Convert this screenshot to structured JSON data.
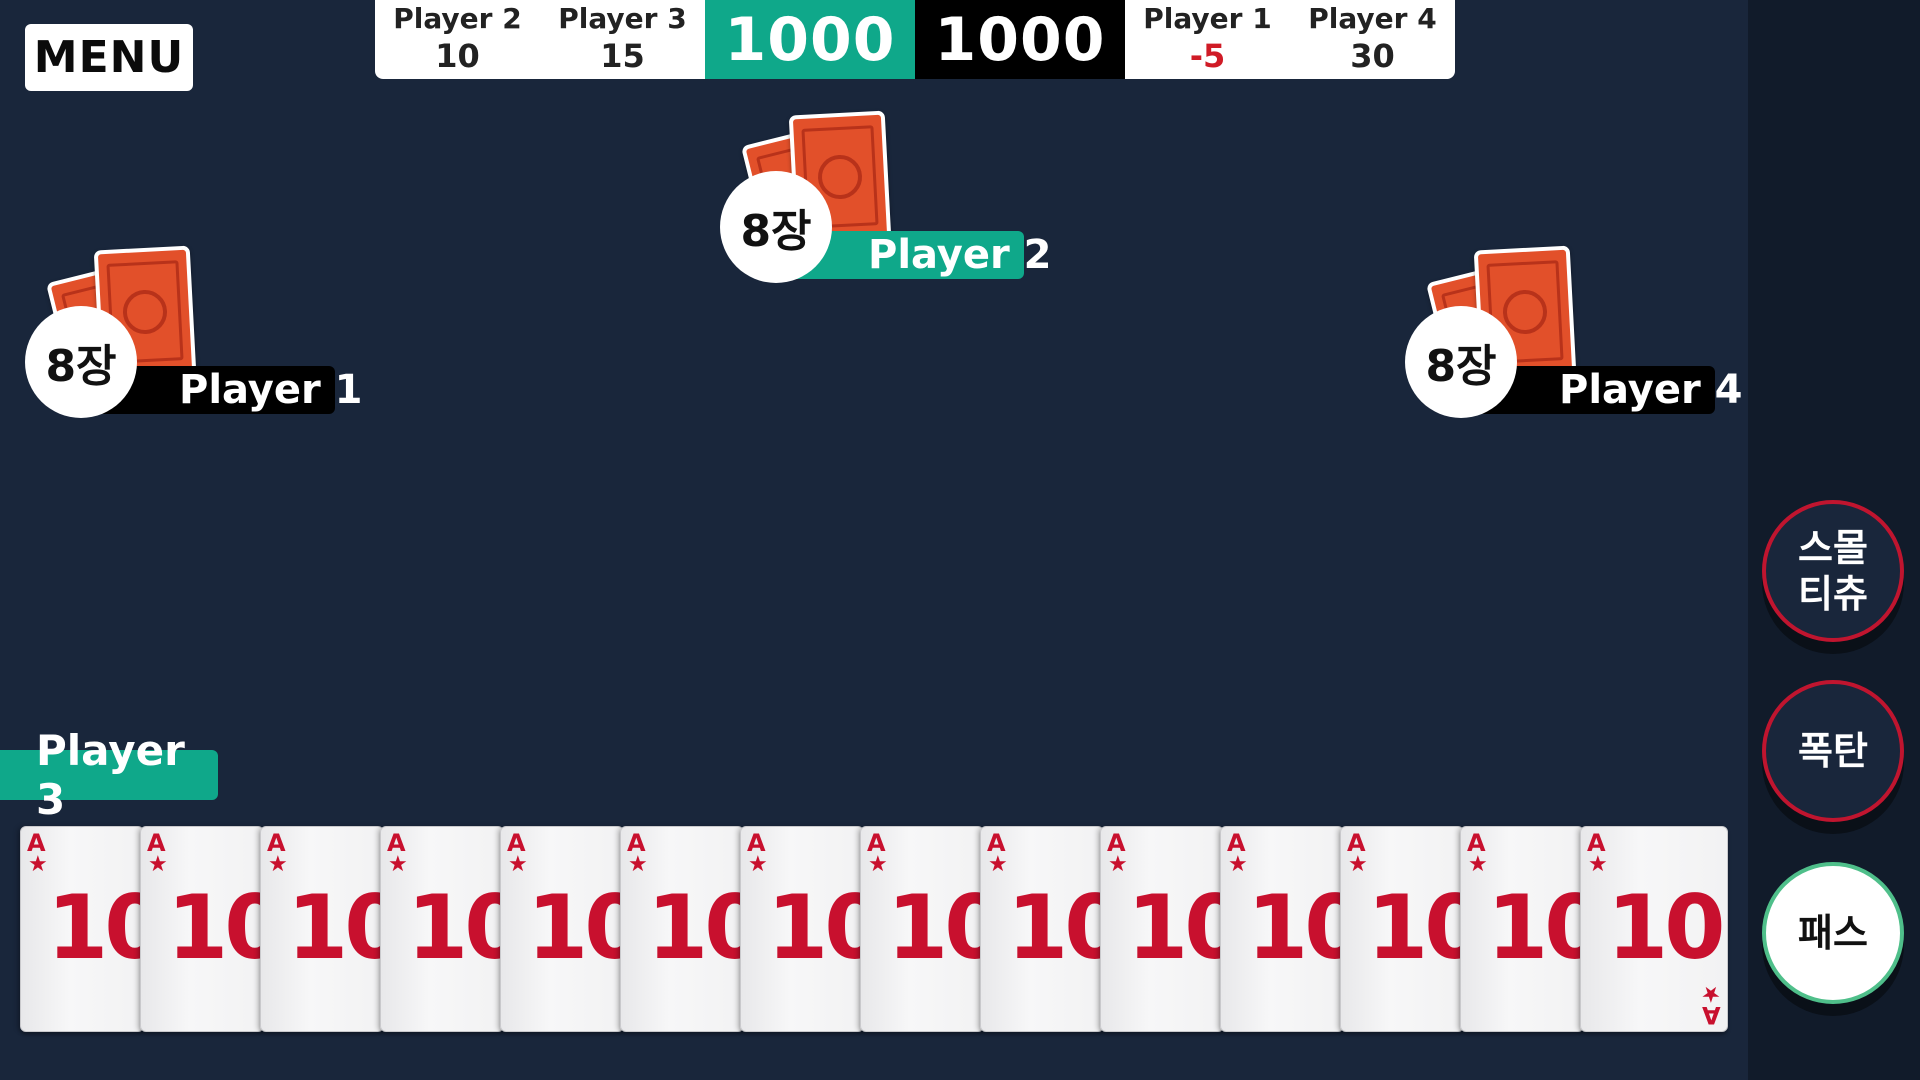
{
  "menu": {
    "label": "MENU"
  },
  "scoreboard": {
    "left": [
      {
        "name": "Player 2",
        "score": "10"
      },
      {
        "name": "Player 3",
        "score": "15"
      }
    ],
    "pot_teal": "1000",
    "pot_black": "1000",
    "right": [
      {
        "name": "Player 1",
        "score": "-5"
      },
      {
        "name": "Player 4",
        "score": "30"
      }
    ]
  },
  "opponents": {
    "player1": {
      "name": "Player 1",
      "count": "8장"
    },
    "player2": {
      "name": "Player 2",
      "count": "8장"
    },
    "player4": {
      "name": "Player 4",
      "count": "8장"
    }
  },
  "me": {
    "name": "Player 3"
  },
  "hand": {
    "cards": [
      {
        "rank": "A",
        "suit": "★",
        "value": "10"
      },
      {
        "rank": "A",
        "suit": "★",
        "value": "10"
      },
      {
        "rank": "A",
        "suit": "★",
        "value": "10"
      },
      {
        "rank": "A",
        "suit": "★",
        "value": "10"
      },
      {
        "rank": "A",
        "suit": "★",
        "value": "10"
      },
      {
        "rank": "A",
        "suit": "★",
        "value": "10"
      },
      {
        "rank": "A",
        "suit": "★",
        "value": "10"
      },
      {
        "rank": "A",
        "suit": "★",
        "value": "10"
      },
      {
        "rank": "A",
        "suit": "★",
        "value": "10"
      },
      {
        "rank": "A",
        "suit": "★",
        "value": "10"
      },
      {
        "rank": "A",
        "suit": "★",
        "value": "10"
      },
      {
        "rank": "A",
        "suit": "★",
        "value": "10"
      },
      {
        "rank": "A",
        "suit": "★",
        "value": "10"
      },
      {
        "rank": "A",
        "suit": "★",
        "value": "10"
      }
    ]
  },
  "actions": {
    "small_tichu": [
      "스몰",
      "티츄"
    ],
    "bomb": "폭탄",
    "pass": "패스"
  },
  "colors": {
    "background": "#19263b",
    "teal": "#0fa88a",
    "card_red": "#c8102e",
    "negative_score": "#d01b26"
  }
}
